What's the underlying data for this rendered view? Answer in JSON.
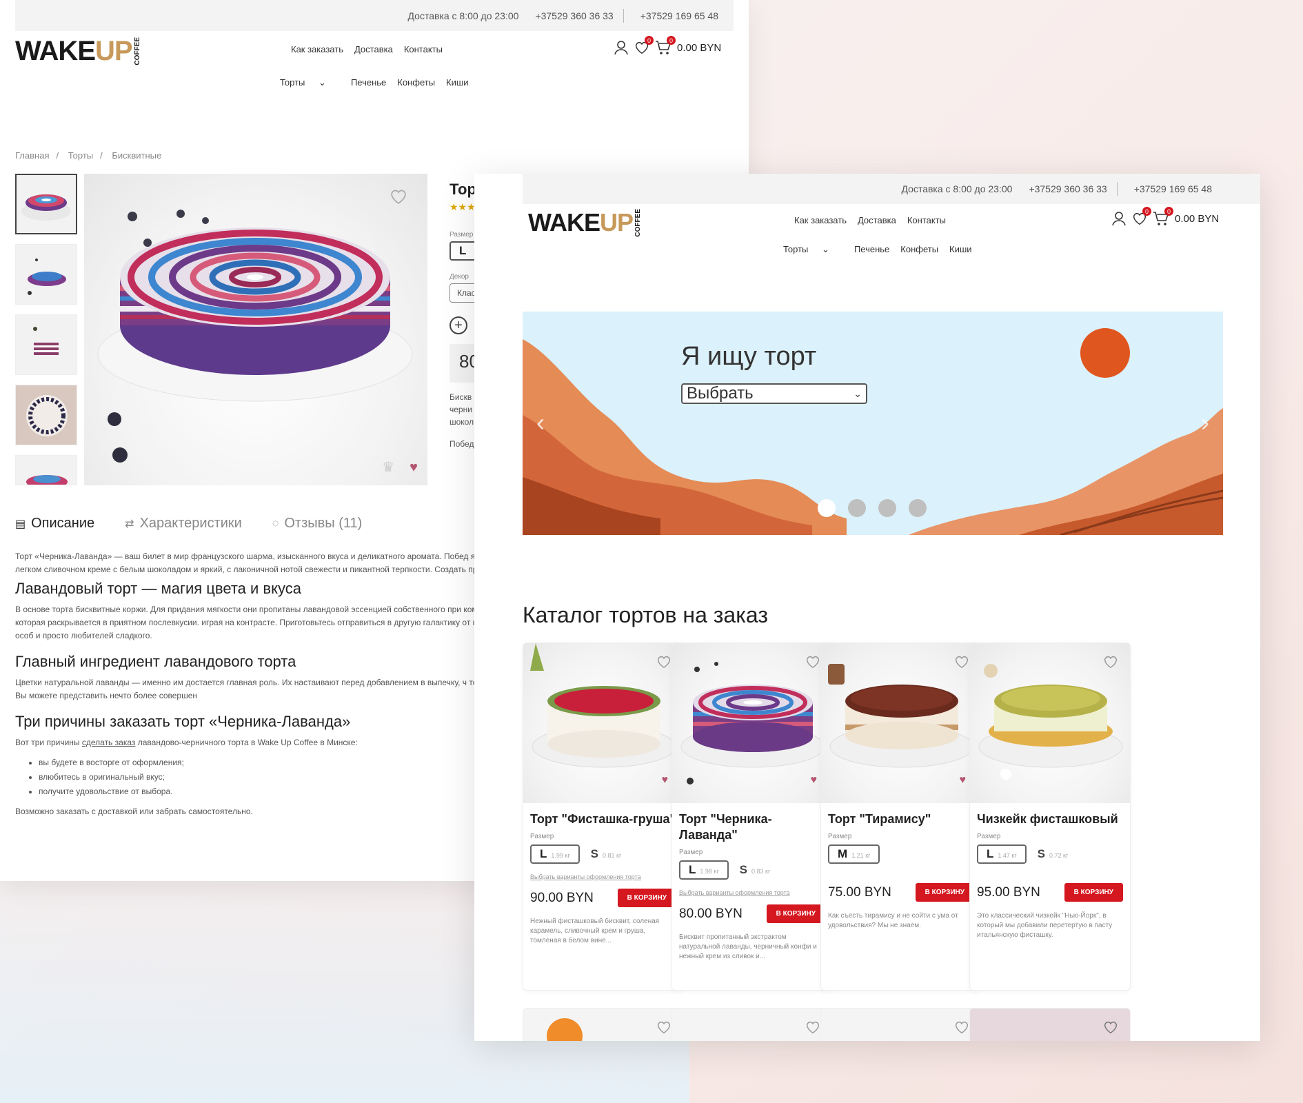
{
  "header": {
    "delivery": "Доставка с 8:00 до 23:00",
    "phone1": "+37529 360 36 33",
    "phone2": "+37529 169 65 48",
    "logo_wake": "WAKE",
    "logo_up": "UP",
    "logo_coffee": "COFFEE",
    "nav_top": [
      "Как заказать",
      "Доставка",
      "Контакты"
    ],
    "nav_sub": [
      "Торты",
      "Печенье",
      "Конфеты",
      "Киши"
    ],
    "cart_total": "0.00 BYN",
    "badge_wish": "0",
    "badge_cart": "0"
  },
  "product_page": {
    "breadcrumbs": [
      "Главная",
      "Торты",
      "Бисквитные"
    ],
    "title_partial": "Тор",
    "size_label": "Размер",
    "size_value": "L",
    "decor_label": "Декор",
    "decor_value": "Клас",
    "price_partial": "80",
    "desc_partial": "Бискв",
    "desc_partial2": "черни",
    "desc_partial3": "шокол",
    "winner_partial": "Побед",
    "tabs": [
      "Описание",
      "Характеристики",
      "Отзывы (11)"
    ],
    "intro": "Торт «Черника-Лаванда» — ваш билет в мир французского шарма, изысканного вкуса и деликатного аромата. Побед ягодно-цветочных десертов. Его секрет в нежной текстуре коржей, легком сливочном креме с белым шоколадом и яркий, с лаконичной нотой свежести и пикантной терпкости. Создать праздник и подарить счастье легко, если купи",
    "h1": "Лавандовый торт — магия цвета и вкуса",
    "p1": "В основе торта бисквитные коржи. Для придания мягкости они пропитаны лавандовой эссенцией собственного при композицию. Натуральные ягоды идеально сочетаются с лавандой, которая раскрывается в приятном послевкусии. играя на контрасте. Приготовьтесь отправиться в другую галактику от наслаждения. Кто побывал там, захочет еще р гурманов, искушенных особ и просто любителей сладкого.",
    "h2": "Главный ингредиент лавандового торта",
    "p2": "Цветки натуральной лаванды — именно им достается главная роль. Их настаивают перед добавлением в выпечку, ч торт в разрезе, вы будете покорены насыщенностью лилового цвета. Вы можете представить нечто более совершен",
    "h3": "Три причины заказать торт «Черника-Лаванда»",
    "p3_before": "Вот три причины ",
    "p3_link": "сделать заказ",
    "p3_after": " лавандово-черничного торта в Wake Up Coffee в Минске:",
    "bullets": [
      "вы будете в восторге от оформления;",
      "влюбитесь в оригинальный вкус;",
      "получите удовольствие от выбора."
    ],
    "footer": "Возможно заказать с доставкой или забрать самостоятельно."
  },
  "home_page": {
    "hero_title": "Я ищу торт",
    "hero_select": "Выбрать",
    "slides_count": 4,
    "active_slide": 1,
    "catalog_title": "Каталог тортов на заказ",
    "size_label": "Размер",
    "variants_link": "Выбрать варианты оформления торта",
    "btn": "В КОРЗИНУ",
    "cards": [
      {
        "name": "Торт \"Фисташка-груша\"",
        "size_main": "L",
        "size_main_w": "1.99 кг",
        "size_alt": "S",
        "size_alt_w": "0.81 кг",
        "price": "90.00 BYN",
        "desc": "Нежный фисташковый бисквит, соленая карамель, сливочный крем и груша, томленая в белом вине..."
      },
      {
        "name": "Торт \"Черника-Лаванда\"",
        "size_main": "L",
        "size_main_w": "1.98 кг",
        "size_alt": "S",
        "size_alt_w": "0.83 кг",
        "price": "80.00 BYN",
        "desc": "Бисквит пропитанный экстрактом натуральной лаванды, черничный конфи и нежный крем из сливок и..."
      },
      {
        "name": "Торт \"Тирамису\"",
        "size_main": "M",
        "size_main_w": "1.21 кг",
        "size_alt": "",
        "size_alt_w": "",
        "price": "75.00 BYN",
        "desc": "Как съесть тирамису и не сойти с ума от удовольствия? Мы не знаем."
      },
      {
        "name": "Чизкейк фисташковый",
        "size_main": "L",
        "size_main_w": "1.47 кг",
        "size_alt": "S",
        "size_alt_w": "0.72 кг",
        "price": "95.00 BYN",
        "desc": "Это классический чизкейк \"Нью-Йорк\", в который мы добавили перетертую в пасту итальянскую фисташку."
      }
    ]
  },
  "colors": {
    "accent": "#d5171f",
    "logo_gold": "#c7995a",
    "hero_sky": "#dbf1fb",
    "hero_land": "#e0703c"
  }
}
